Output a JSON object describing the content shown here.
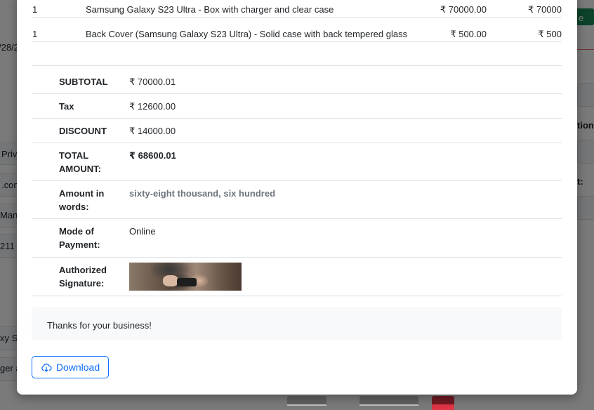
{
  "background": {
    "fragments": [
      "/28/2",
      "Priva",
      ".com",
      "Mane",
      "211",
      "xy S",
      "ger a",
      "tion",
      "t:",
      "e"
    ]
  },
  "items": [
    {
      "qty": "1",
      "description": "Samsung Galaxy S23 Ultra - Box with charger and clear case",
      "price": "₹ 70000.00",
      "total": "₹ 70000"
    },
    {
      "qty": "1",
      "description": "Back Cover (Samsung Galaxy S23 Ultra) - Solid case with back tempered glass",
      "price": "₹ 500.00",
      "total": "₹ 500"
    }
  ],
  "summary": {
    "subtotal_label": "SUBTOTAL",
    "subtotal_value": "₹ 70000.01",
    "tax_label": "Tax",
    "tax_value": "₹ 12600.00",
    "discount_label": "DISCOUNT",
    "discount_value": "₹ 14000.00",
    "total_label": "TOTAL AMOUNT:",
    "total_value": "₹ 68600.01",
    "words_label": "Amount in words:",
    "words_value": "sixty-eight thousand, six hundred",
    "payment_label": "Mode of Payment:",
    "payment_value": "Online",
    "signature_label": "Authorized Signature:"
  },
  "footer": {
    "thanks": "Thanks for your business!",
    "download_label": "Download"
  },
  "colors": {
    "primary": "#0d6efd",
    "muted": "#6c757d"
  }
}
